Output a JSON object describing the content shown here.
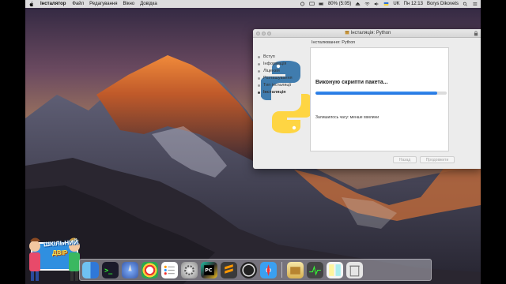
{
  "menubar": {
    "app_name": "Інсталятор",
    "menus": [
      "Файл",
      "Редагування",
      "Вікно",
      "Довідка"
    ],
    "battery": "80% (5:05)",
    "language": "UK",
    "clock": "Пн 12:13",
    "user": "Borys Dikovets"
  },
  "window": {
    "title": "Інсталяція: Python",
    "header": "Інсталювання: Python",
    "steps": [
      {
        "label": "Вступ",
        "active": false
      },
      {
        "label": "Інформація",
        "active": false
      },
      {
        "label": "Ліцензія",
        "active": false
      },
      {
        "label": "Розташування",
        "active": false
      },
      {
        "label": "Тип інсталяції",
        "active": false
      },
      {
        "label": "Інсталяція",
        "active": true
      }
    ],
    "status": "Виконую скрипти пакета...",
    "progress": 0.93,
    "time_remaining": "Залишилось часу: менше хвилини",
    "buttons": {
      "back": "Назад",
      "continue": "Продовжити"
    }
  },
  "watermark": {
    "line1": "ШКІЛЬНИЙ",
    "line2": "ДВІР"
  },
  "dock": {
    "apps": [
      "finder-icon",
      "siri-icon",
      "launchpad-icon",
      "safari-icon",
      "chrome-icon",
      "reminders-icon",
      "terminal-icon",
      "activity-monitor-icon",
      "system-preferences-icon",
      "pycharm-icon",
      "sublime-text-icon",
      "obs-icon",
      "xcode-icon",
      "preview-icon",
      "python-launcher-icon",
      "installer-icon",
      "stickies-icon",
      "downloads-stack-icon",
      "trash-icon"
    ]
  },
  "colors": {
    "accent": "#1c6fde",
    "python_blue": "#3776ab",
    "python_yellow": "#ffd43b"
  }
}
